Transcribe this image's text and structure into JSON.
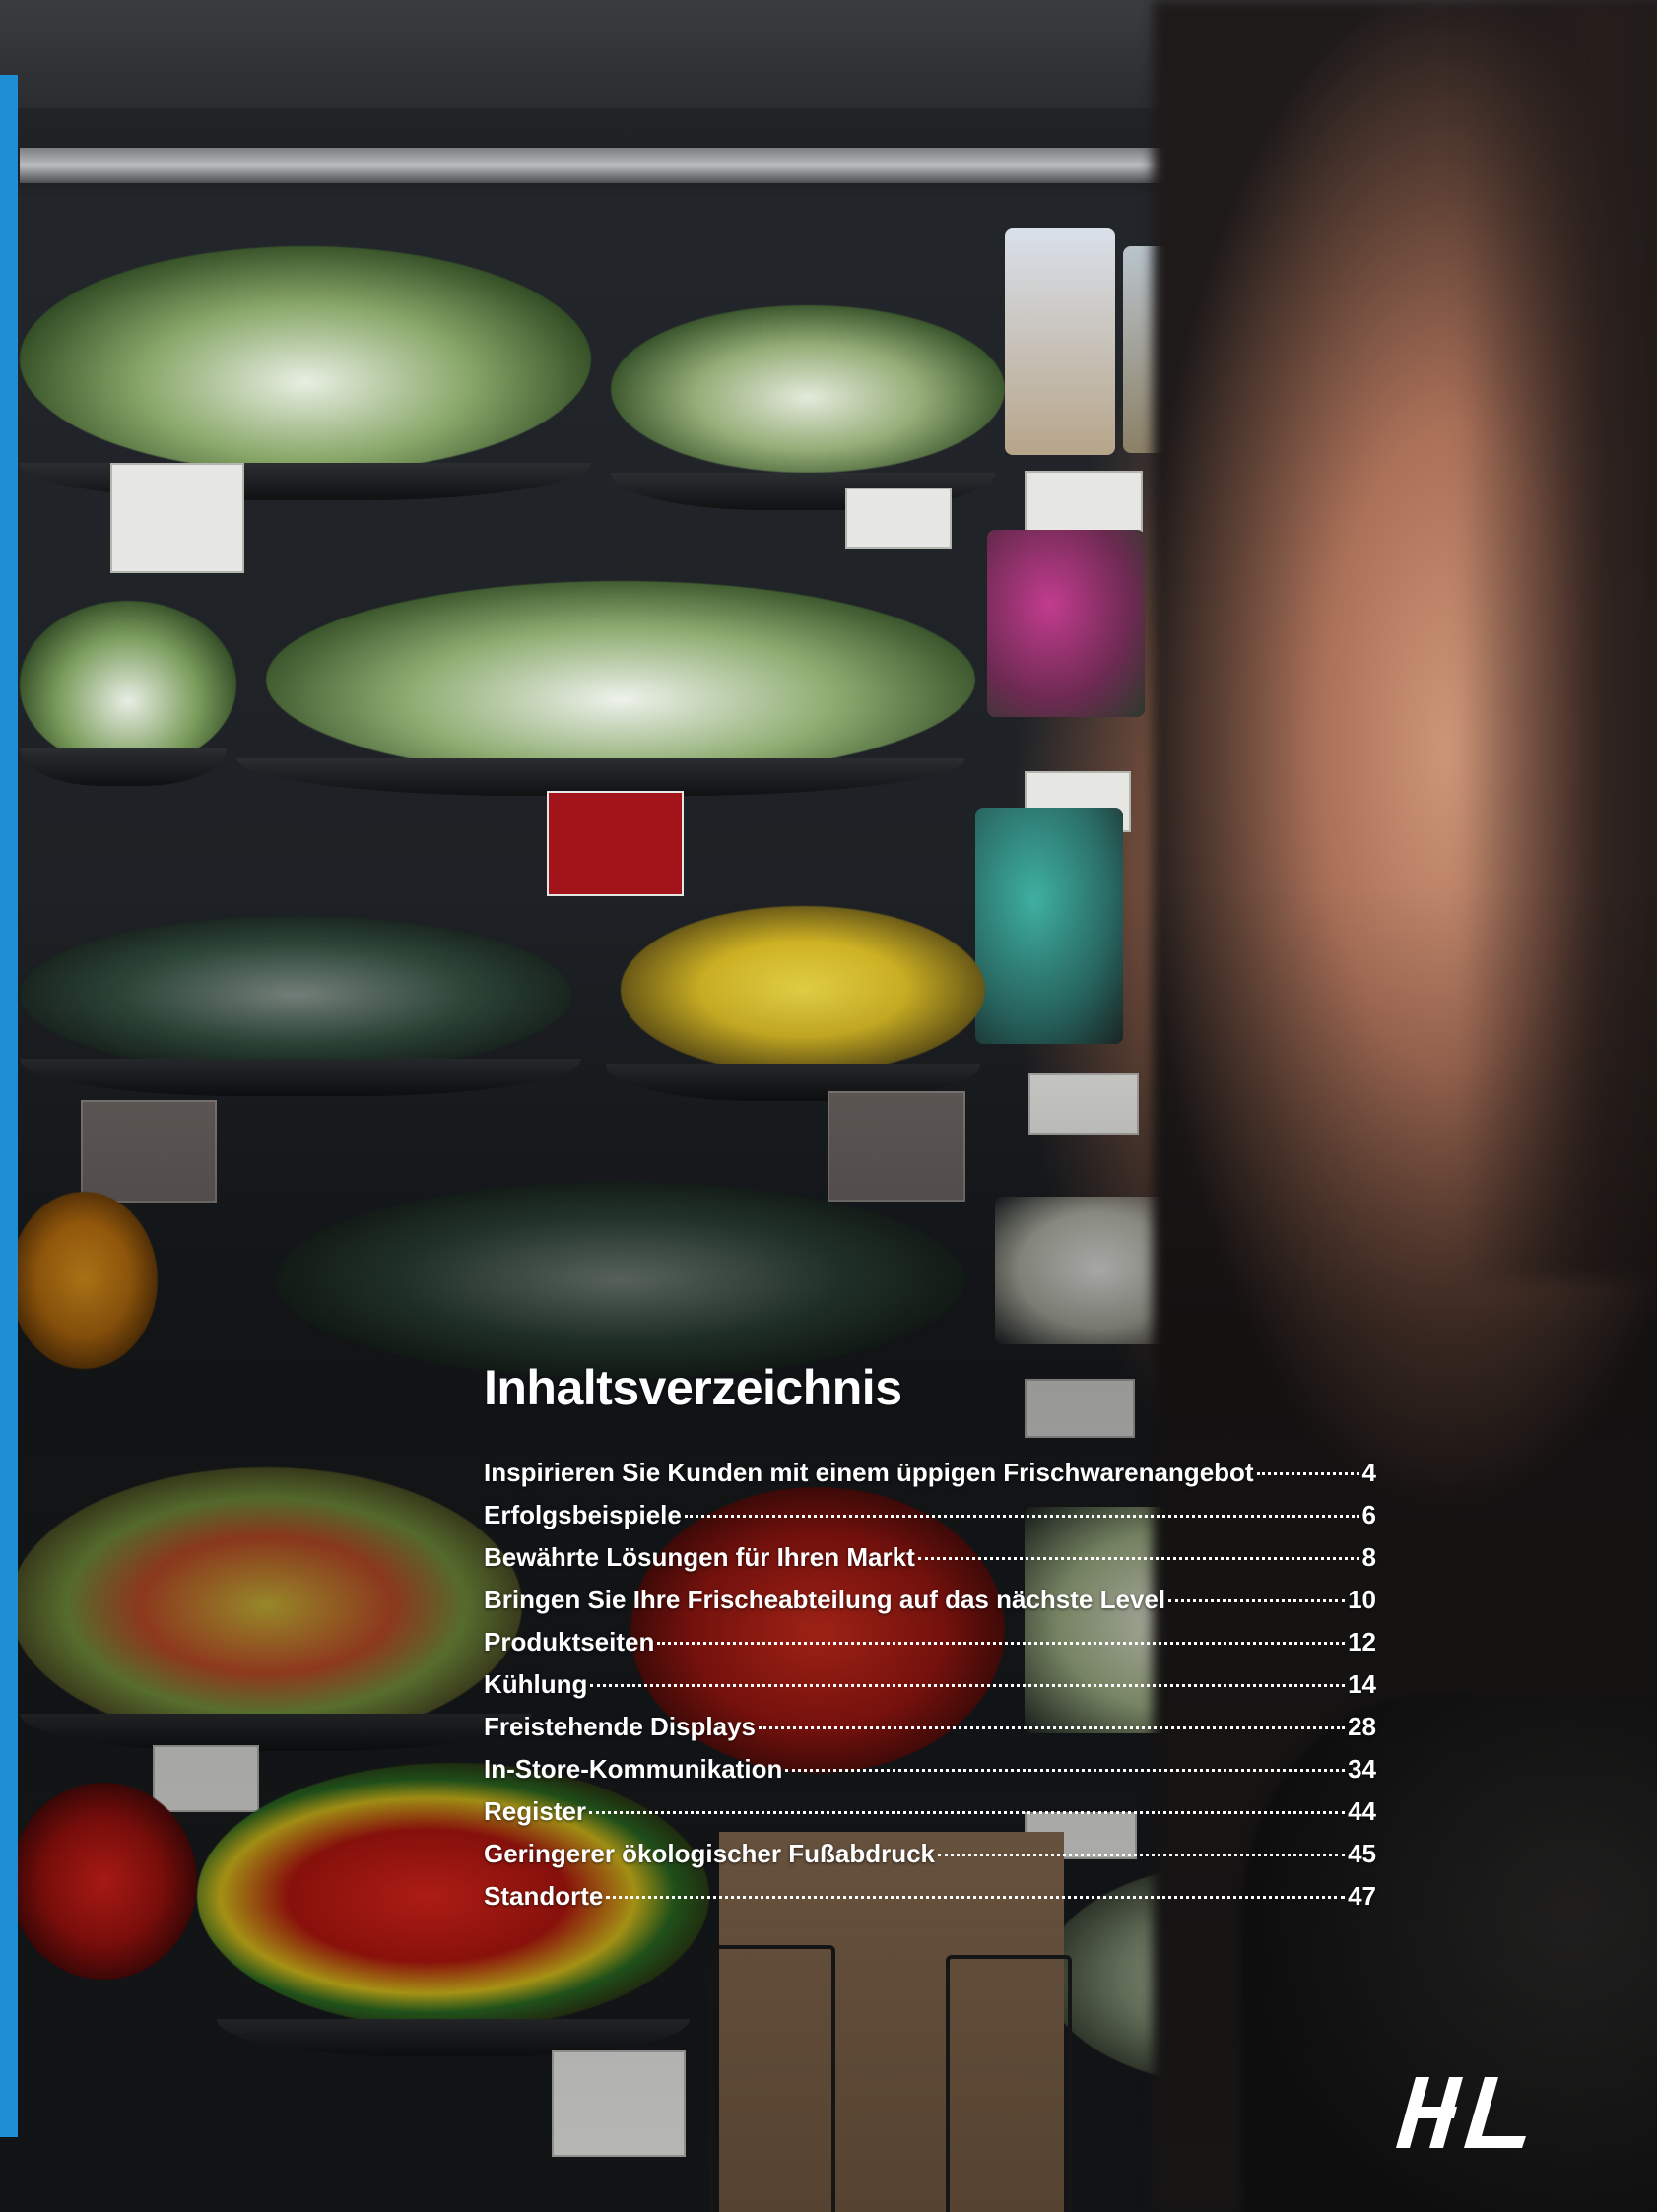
{
  "toc": {
    "title": "Inhaltsverzeichnis",
    "entries": [
      {
        "label": "Inspirieren Sie Kunden mit einem üppigen Frischwarenangebot",
        "page": "4"
      },
      {
        "label": "Erfolgsbeispiele",
        "page": "6"
      },
      {
        "label": "Bewährte Lösungen für Ihren Markt",
        "page": "8"
      },
      {
        "label": "Bringen Sie Ihre Frischeabteilung auf das nächste Level",
        "page": "10"
      },
      {
        "label": "Produktseiten",
        "page": "12"
      },
      {
        "label": "Kühlung",
        "page": "14"
      },
      {
        "label": "Freistehende Displays",
        "page": "28"
      },
      {
        "label": "In-Store-Kommunikation",
        "page": "34"
      },
      {
        "label": "Register",
        "page": "44"
      },
      {
        "label": "Geringerer ökologischer Fußabdruck",
        "page": "45"
      },
      {
        "label": "Standorte",
        "page": "47"
      }
    ]
  },
  "colors": {
    "accent": "#1e8fd5",
    "text": "#ffffff"
  },
  "logo": {
    "icon": "hl-logo-icon"
  }
}
